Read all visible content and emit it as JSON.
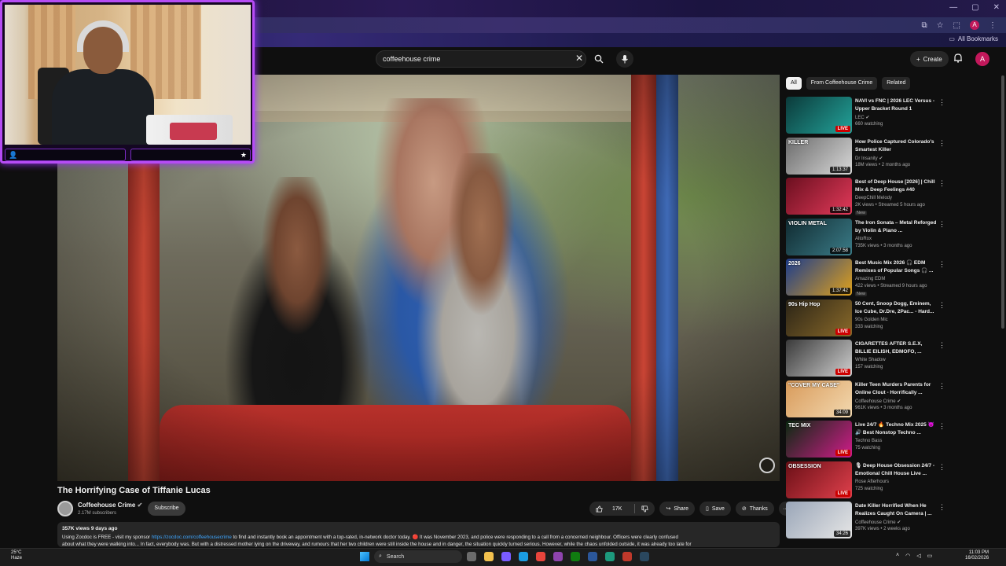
{
  "browser": {
    "bookmarks_label": "All Bookmarks",
    "profile_initial": "A"
  },
  "search": {
    "query": "coffeehouse crime"
  },
  "header": {
    "create_label": "Create",
    "account_initial": "A"
  },
  "webcam": {
    "left_glyph": "👤",
    "right_glyph": "★"
  },
  "video": {
    "title": "The Horrifying Case of Tiffanie Lucas",
    "channel_name": "Coffeehouse Crime",
    "subscribers": "2.17M subscribers",
    "subscribe_label": "Subscribe",
    "likes": "17K",
    "share_label": "Share",
    "save_label": "Save",
    "thanks_label": "Thanks",
    "more_label": "···",
    "views_date": "357K views  9 days ago",
    "desc_prefix": "Using Zocdoc is FREE - visit my sponsor ",
    "desc_link": "https://zocdoc.com/coffeehousecrime",
    "desc_rest": " to find and instantly book an appointment with a top-rated, in-network doctor today. 🔴 It was November 2023, and police were responding to a call from a concerned neighbour. Officers were clearly confused",
    "desc_line2": "about what they were walking into... In fact, everybody was. But with a distressed mother lying on the driveway, and rumours that her two children were still inside the house and in danger, the situation quickly turned serious. However, while the chaos unfolded outside, it was already too late for"
  },
  "chips": [
    "All",
    "From Coffeehouse Crime",
    "Related"
  ],
  "recommendations": [
    {
      "title": "NAVI vs FNC | 2026 LEC Versus - Upper Bracket Round 1",
      "channel": "LEC ✔",
      "meta": "660 watching",
      "badge": "LIVE",
      "live": true,
      "thumb_label": "",
      "new": "",
      "color_a": "#0b3a3a",
      "color_b": "#23a39a"
    },
    {
      "title": "How Police Captured Colorado's Smartest Killer",
      "channel": "Dr Insanity ✔",
      "meta": "18M views • 2 months ago",
      "badge": "1:13:37",
      "live": false,
      "thumb_label": "KILLER",
      "new": "",
      "color_a": "#6b6b6b",
      "color_b": "#d9d9d9"
    },
    {
      "title": "Best of Deep House [2026] | Chill Mix & Deep Feelings #40",
      "channel": "DeepChill Melody",
      "meta": "2K views • Streamed 5 hours ago",
      "badge": "1:32:42",
      "live": false,
      "thumb_label": "",
      "new": "New",
      "color_a": "#6b0f1f",
      "color_b": "#e33a5a"
    },
    {
      "title": "The Iron Sonata – Metal Reforged by Violin & Piano ...",
      "channel": "AltoRox",
      "meta": "735K views • 3 months ago",
      "badge": "2:07:58",
      "live": false,
      "thumb_label": "VIOLIN METAL",
      "new": "",
      "color_a": "#102a30",
      "color_b": "#3b7c88"
    },
    {
      "title": "Best Music Mix 2026 🎧 EDM Remixes of Popular Songs 🎧 ...",
      "channel": "Amazing EDM",
      "meta": "422 views • Streamed 9 hours ago",
      "badge": "1:37:42",
      "live": false,
      "thumb_label": "2026",
      "new": "New",
      "color_a": "#1c3c8c",
      "color_b": "#e0a11b"
    },
    {
      "title": "50 Cent, Snoop Dogg, Eminem, Ice Cube, Dr.Dre, 2Pac... - Hard...",
      "channel": "90s Golden Mic",
      "meta": "333 watching",
      "badge": "LIVE",
      "live": true,
      "thumb_label": "90s Hip Hop",
      "new": "",
      "color_a": "#2b2416",
      "color_b": "#8a6a2a"
    },
    {
      "title": "CIGARETTES AFTER S.E.X, BILLIE EILISH, EDMOFO, ...",
      "channel": "White Shadow",
      "meta": "157 watching",
      "badge": "LIVE",
      "live": true,
      "thumb_label": "",
      "new": "",
      "color_a": "#3a3a3a",
      "color_b": "#cfcfcf"
    },
    {
      "title": "Killer Teen Murders Parents for Online Clout - Horrifically ...",
      "channel": "Coffeehouse Crime ✔",
      "meta": "961K views • 3 months ago",
      "badge": "34:09",
      "live": false,
      "thumb_label": "\"COVER MY CASE\"",
      "new": "",
      "color_a": "#d89a5a",
      "color_b": "#f3d9b0"
    },
    {
      "title": "Live 24/7 🔥 Techno Mix 2025 😈🔊 Best Nonstop Techno ...",
      "channel": "Techno Bass",
      "meta": "75 watching",
      "badge": "LIVE",
      "live": true,
      "thumb_label": "TEC MIX",
      "new": "",
      "color_a": "#0a2a10",
      "color_b": "#d21c8a"
    },
    {
      "title": "🎙 Deep House Obsession 24/7 - Emotional Chill House Live ...",
      "channel": "Rose Afterhours",
      "meta": "725 watching",
      "badge": "LIVE",
      "live": true,
      "thumb_label": "OBSESSION",
      "new": "",
      "color_a": "#6a0f16",
      "color_b": "#e0404c"
    },
    {
      "title": "Date Killer Horrified When He Realizes Caught On Camera | ...",
      "channel": "Coffeehouse Crime ✔",
      "meta": "397K views • 2 weeks ago",
      "badge": "34:26",
      "live": false,
      "thumb_label": "",
      "new": "",
      "color_a": "#9aa6b8",
      "color_b": "#e6e6e6"
    }
  ],
  "taskbar": {
    "weather_temp": "25°C",
    "weather_desc": "Haze",
    "search_label": "Search",
    "time": "11:03 PM",
    "date": "16/02/2026"
  }
}
